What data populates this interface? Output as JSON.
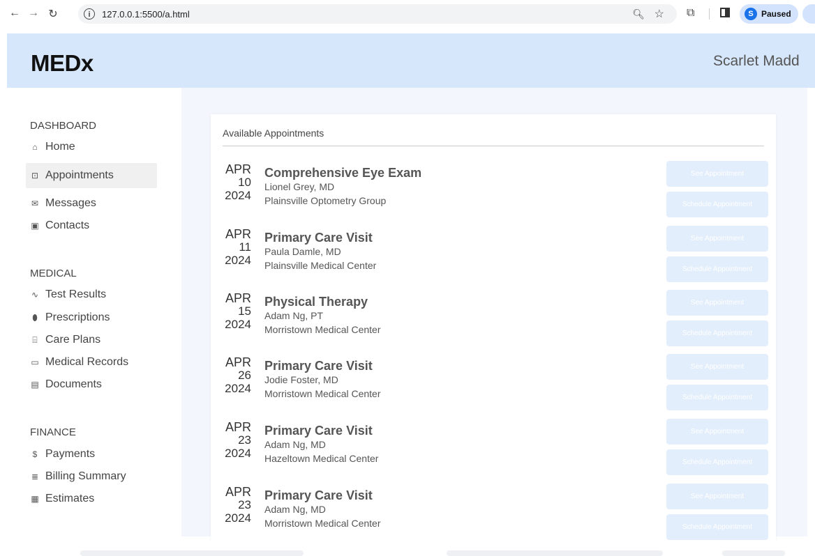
{
  "browser": {
    "url": "127.0.0.1:5500/a.html",
    "profile_initial": "S",
    "profile_status": "Paused"
  },
  "app": {
    "logo": "MEDx",
    "user_name": "Scarlet Madd"
  },
  "sidebar": {
    "sections": [
      {
        "title": "DASHBOARD",
        "items": [
          {
            "label": "Home",
            "icon": "home-icon"
          },
          {
            "label": "Appointments",
            "icon": "calendar-icon",
            "active": true
          },
          {
            "label": "Messages",
            "icon": "mail-icon"
          },
          {
            "label": "Contacts",
            "icon": "contact-card-icon"
          }
        ]
      },
      {
        "title": "MEDICAL",
        "items": [
          {
            "label": "Test Results",
            "icon": "pulse-icon"
          },
          {
            "label": "Prescriptions",
            "icon": "pill-icon"
          },
          {
            "label": "Care Plans",
            "icon": "hospital-icon"
          },
          {
            "label": "Medical Records",
            "icon": "folder-icon"
          },
          {
            "label": "Documents",
            "icon": "document-icon"
          }
        ]
      },
      {
        "title": "FINANCE",
        "items": [
          {
            "label": "Payments",
            "icon": "dollar-icon"
          },
          {
            "label": "Billing Summary",
            "icon": "list-icon"
          },
          {
            "label": "Estimates",
            "icon": "calculator-icon"
          }
        ]
      }
    ]
  },
  "main": {
    "card_title": "Available Appointments",
    "see_label": "See Appointment",
    "schedule_label": "Schedule Appointment",
    "appointments": [
      {
        "month": "APR",
        "day": "10",
        "year": "2024",
        "title": "Comprehensive Eye Exam",
        "doctor": "Lionel Grey, MD",
        "location": "Plainsville Optometry Group"
      },
      {
        "month": "APR",
        "day": "11",
        "year": "2024",
        "title": "Primary Care Visit",
        "doctor": "Paula Damle, MD",
        "location": "Plainsville Medical Center"
      },
      {
        "month": "APR",
        "day": "15",
        "year": "2024",
        "title": "Physical Therapy",
        "doctor": "Adam Ng, PT",
        "location": "Morristown Medical Center"
      },
      {
        "month": "APR",
        "day": "26",
        "year": "2024",
        "title": "Primary Care Visit",
        "doctor": "Jodie Foster, MD",
        "location": "Morristown Medical Center"
      },
      {
        "month": "APR",
        "day": "23",
        "year": "2024",
        "title": "Primary Care Visit",
        "doctor": "Adam Ng, MD",
        "location": "Hazeltown Medical Center"
      },
      {
        "month": "APR",
        "day": "23",
        "year": "2024",
        "title": "Primary Care Visit",
        "doctor": "Adam Ng, MD",
        "location": "Morristown Medical Center"
      }
    ]
  },
  "colors": {
    "header_bg": "#d6e6fb",
    "main_bg": "#f3f7fd",
    "button_bg": "#e3eefc"
  }
}
